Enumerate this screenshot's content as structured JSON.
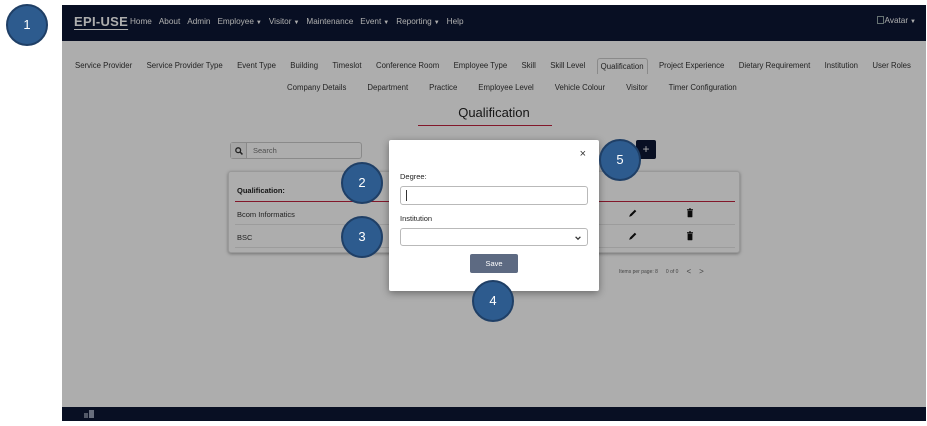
{
  "topbar": {
    "logo": "EPI-USE",
    "nav": [
      {
        "label": "Home",
        "caret": false
      },
      {
        "label": "About",
        "caret": false
      },
      {
        "label": "Admin",
        "caret": false
      },
      {
        "label": "Employee",
        "caret": true
      },
      {
        "label": "Visitor",
        "caret": true
      },
      {
        "label": "Maintenance",
        "caret": false
      },
      {
        "label": "Event",
        "caret": true
      },
      {
        "label": "Reporting",
        "caret": true
      },
      {
        "label": "Help",
        "caret": false
      }
    ],
    "avatar_alt": "Avatar"
  },
  "subnav": {
    "row1": [
      "Service Provider",
      "Service Provider Type",
      "Event Type",
      "Building",
      "Timeslot",
      "Conference Room",
      "Employee Type",
      "Skill",
      "Skill Level",
      "Qualification",
      "Project Experience",
      "Dietary Requirement",
      "Institution",
      "User Roles"
    ],
    "row2": [
      "Company Details",
      "Department",
      "Practice",
      "Employee Level",
      "Vehicle Colour",
      "Visitor",
      "Timer Configuration"
    ],
    "active": "Qualification"
  },
  "page": {
    "title": "Qualification",
    "search_placeholder": "Search",
    "add_label": "+"
  },
  "table": {
    "header": "Qualification:",
    "rows": [
      "Bcom Informatics",
      "BSC"
    ]
  },
  "pagination": {
    "items_per_page": "Items per page: 8",
    "range": "0 of 0",
    "prev": "<",
    "next": ">"
  },
  "modal": {
    "close": "×",
    "degree_label": "Degree:",
    "degree_value": "",
    "institution_label": "Institution",
    "institution_value": "",
    "save_label": "Save"
  },
  "callouts": [
    "1",
    "2",
    "3",
    "4",
    "5"
  ],
  "colors": {
    "navbar": "#0c1734",
    "accent": "#c0233f",
    "save_button": "#5d6a82",
    "callout": "#2d5b8e"
  }
}
